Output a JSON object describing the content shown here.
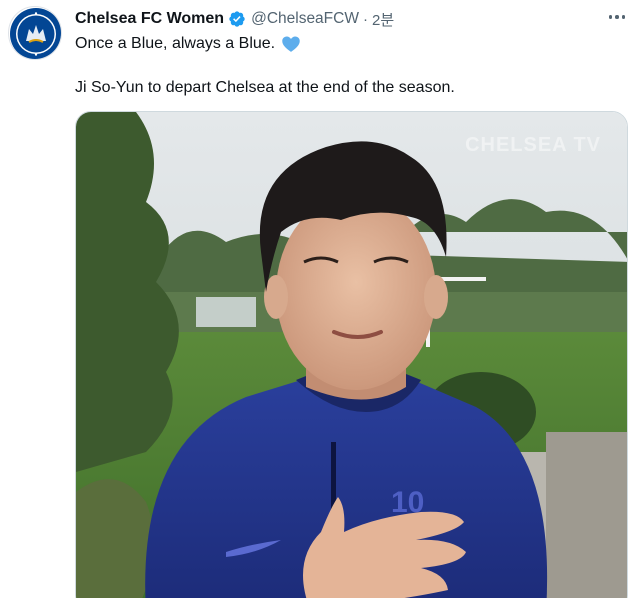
{
  "tweet": {
    "author_name": "Chelsea FC Women",
    "handle": "@ChelseaFCW",
    "separator": "·",
    "time": "2분",
    "line1": "Once a Blue, always a Blue.",
    "line2": "Ji So-Yun to depart Chelsea at the end of the season."
  },
  "icons": {
    "avatar": "chelsea-crest",
    "verified": "verified-badge-icon",
    "heart": "blue-heart-emoji",
    "more": "more-options-icon"
  },
  "colors": {
    "chelsea_blue": "#034694",
    "verified_blue": "#1d9bf0",
    "heart_blue": "#5dadec",
    "secondary_text": "#536471"
  },
  "media": {
    "watermark": "CHELSEA TV",
    "jersey_number": "10"
  }
}
